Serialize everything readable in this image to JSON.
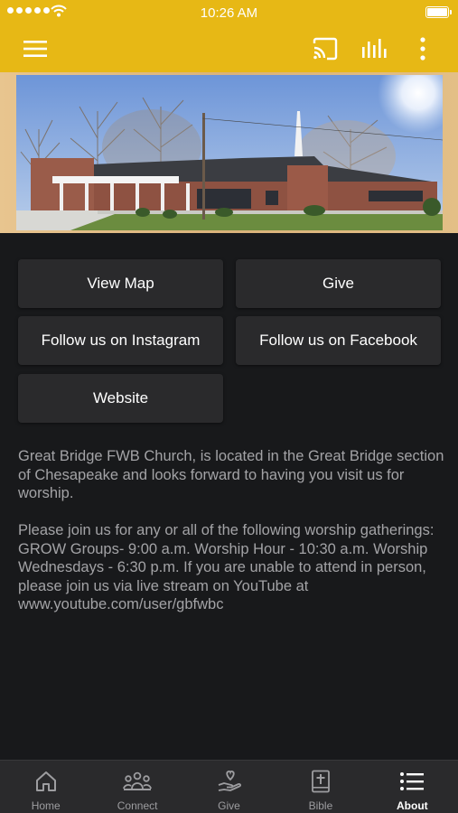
{
  "status_bar": {
    "time": "10:26 AM"
  },
  "app_bar": {
    "icons": [
      "menu-icon",
      "cast-icon",
      "equalizer-icon",
      "more-vert-icon"
    ]
  },
  "colors": {
    "accent": "#e7b815",
    "background": "#18191b",
    "button": "#2a2a2c",
    "text_muted": "#a3a3a6"
  },
  "buttons": {
    "view_map": "View Map",
    "give": "Give",
    "instagram": "Follow us on Instagram",
    "facebook": "Follow us on Facebook",
    "website": "Website"
  },
  "description": {
    "p1": "Great Bridge FWB Church, is located in the Great Bridge section of Chesapeake and looks forward to having you visit us for worship.",
    "p2": "Please join us for any or all of the following worship gatherings: GROW Groups- 9:00 a.m. Worship Hour - 10:30 a.m. Worship Wednesdays - 6:30 p.m. If you are unable to attend in person, please join us via live stream on YouTube at www.youtube.com/user/gbfwbc"
  },
  "tabs": [
    {
      "label": "Home",
      "icon": "home-icon"
    },
    {
      "label": "Connect",
      "icon": "people-icon"
    },
    {
      "label": "Give",
      "icon": "give-heart-icon"
    },
    {
      "label": "Bible",
      "icon": "bible-icon"
    },
    {
      "label": "About",
      "icon": "list-icon",
      "active": true
    }
  ]
}
